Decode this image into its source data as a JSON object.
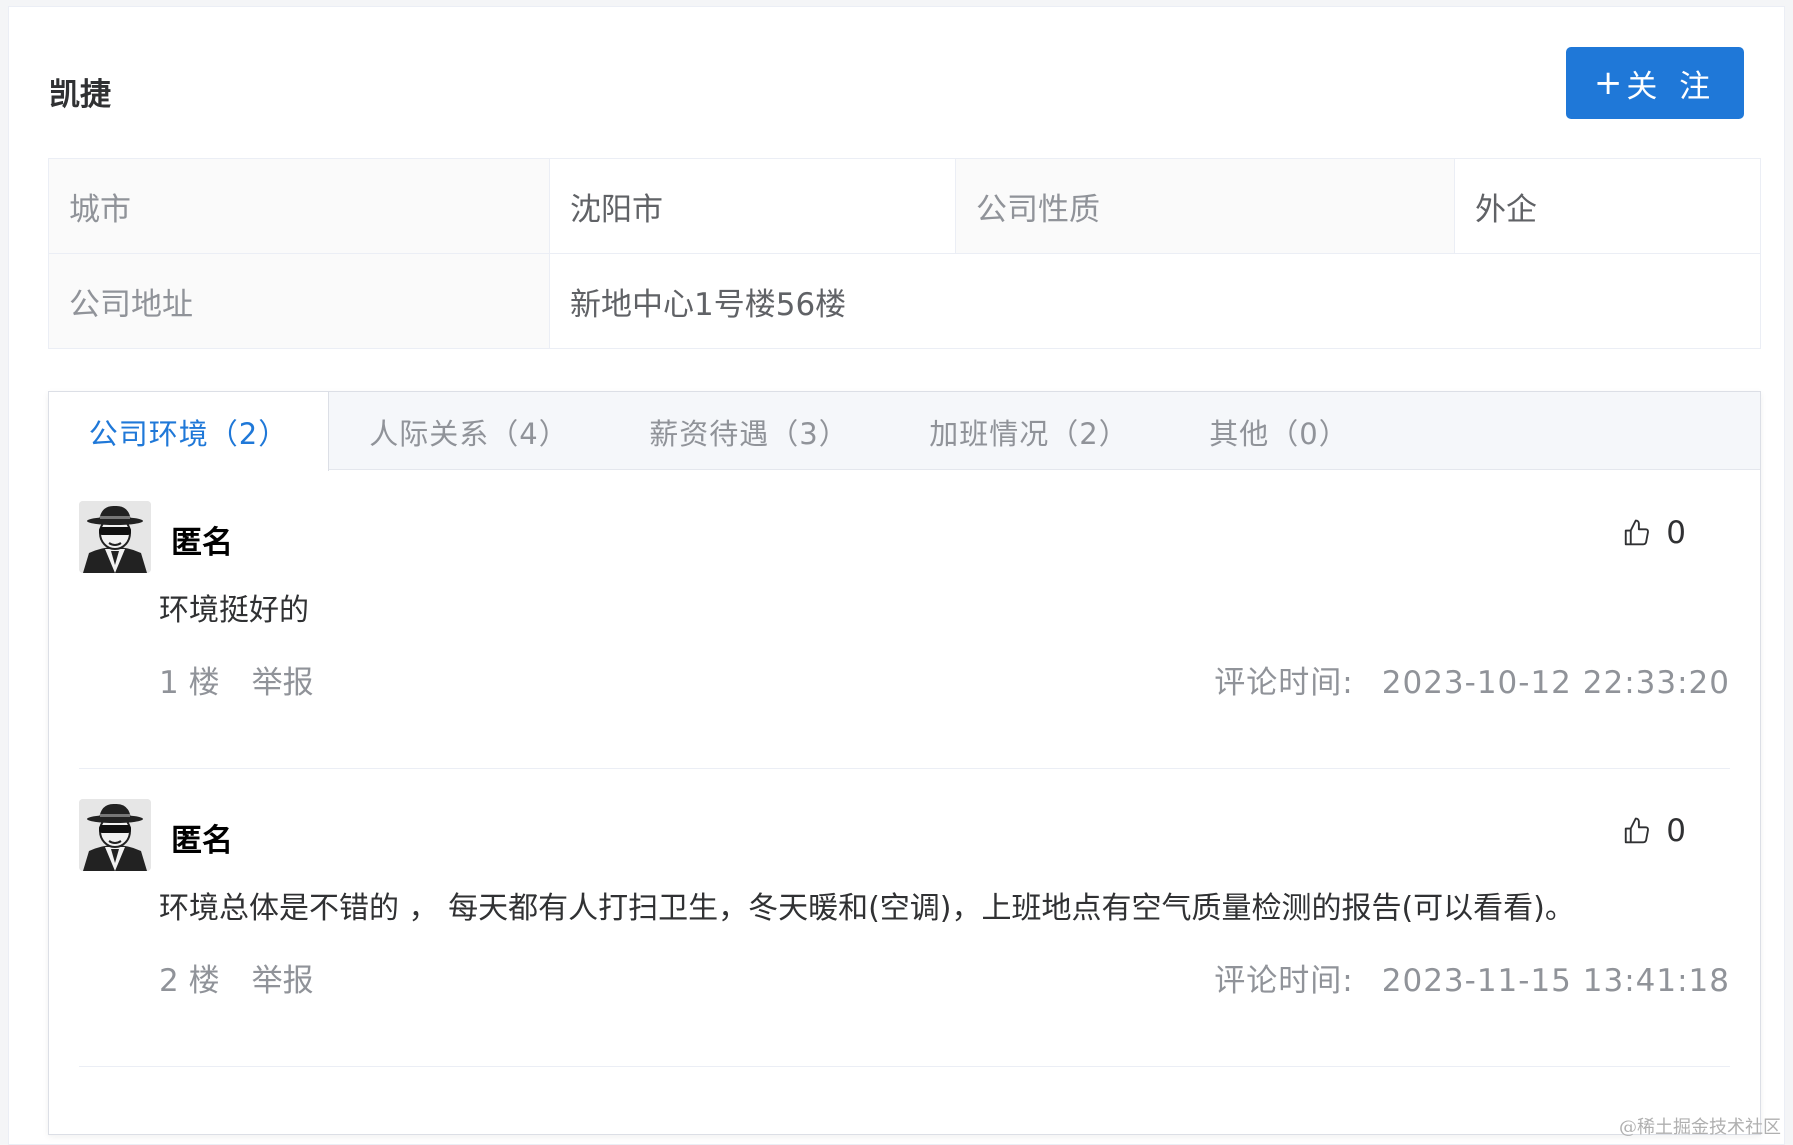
{
  "company": {
    "name": "凯捷"
  },
  "follow_button": {
    "plus": "+",
    "label": "关 注"
  },
  "info": {
    "city_label": "城市",
    "city_value": "沈阳市",
    "nature_label": "公司性质",
    "nature_value": "外企",
    "address_label": "公司地址",
    "address_value": "新地中心1号楼56楼"
  },
  "tabs": [
    {
      "label": "公司环境（2）"
    },
    {
      "label": "人际关系（4）"
    },
    {
      "label": "薪资待遇（3）"
    },
    {
      "label": "加班情况（2）"
    },
    {
      "label": "其他（0）"
    }
  ],
  "comments": [
    {
      "user": "匿名",
      "likes": "0",
      "content": "环境挺好的",
      "floor": "1 楼",
      "report": "举报",
      "time_label": "评论时间:",
      "time": "2023-10-12 22:33:20"
    },
    {
      "user": "匿名",
      "likes": "0",
      "content": "环境总体是不错的 ， 每天都有人打扫卫生，冬天暖和(空调)，上班地点有空气质量检测的报告(可以看看)。",
      "floor": "2 楼",
      "report": "举报",
      "time_label": "评论时间:",
      "time": "2023-11-15 13:41:18"
    }
  ],
  "watermark": "@稀土掘金技术社区",
  "colors": {
    "primary": "#1f78d8",
    "muted": "#909399"
  }
}
